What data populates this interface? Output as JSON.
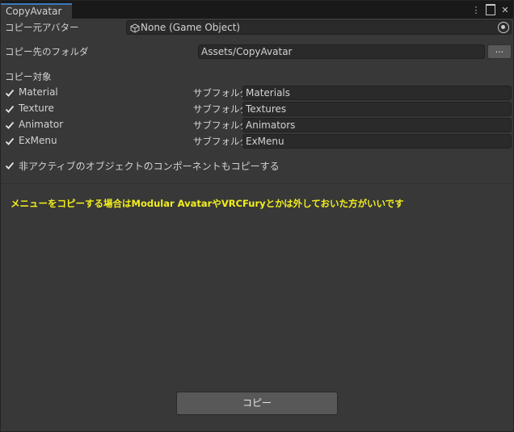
{
  "window": {
    "tab_title": "CopyAvatar",
    "menu_icon": "⋮",
    "maximize_icon": "maximize-icon",
    "close_icon": "✕"
  },
  "source": {
    "label": "コピー元アバター",
    "value": "None (Game Object)",
    "icon": "gameobject-cube-icon",
    "picker_icon": "object-picker-icon"
  },
  "dest": {
    "label": "コピー先のフォルダ",
    "value": "Assets/CopyAvatar",
    "browse_label": "..."
  },
  "targets": {
    "header": "コピー対象",
    "items": [
      {
        "label": "Material",
        "checked": true,
        "sub_label": "サブフォルダ",
        "sub_value": "Materials"
      },
      {
        "label": "Texture",
        "checked": true,
        "sub_label": "サブフォルダ",
        "sub_value": "Textures"
      },
      {
        "label": "Animator",
        "checked": true,
        "sub_label": "サブフォルダ",
        "sub_value": "Animators"
      },
      {
        "label": "ExMenu",
        "checked": true,
        "sub_label": "サブフォルダ",
        "sub_value": "ExMenu"
      }
    ]
  },
  "inactive_option": {
    "label": "非アクティブのオブジェクトのコンポーネントもコピーする",
    "checked": true
  },
  "warning": {
    "text": "メニューをコピーする場合はModular AvatarやVRCFuryとかは外しておいた方がいいです",
    "color": "#f2ee1d"
  },
  "copy_button": {
    "label": "コピー"
  }
}
